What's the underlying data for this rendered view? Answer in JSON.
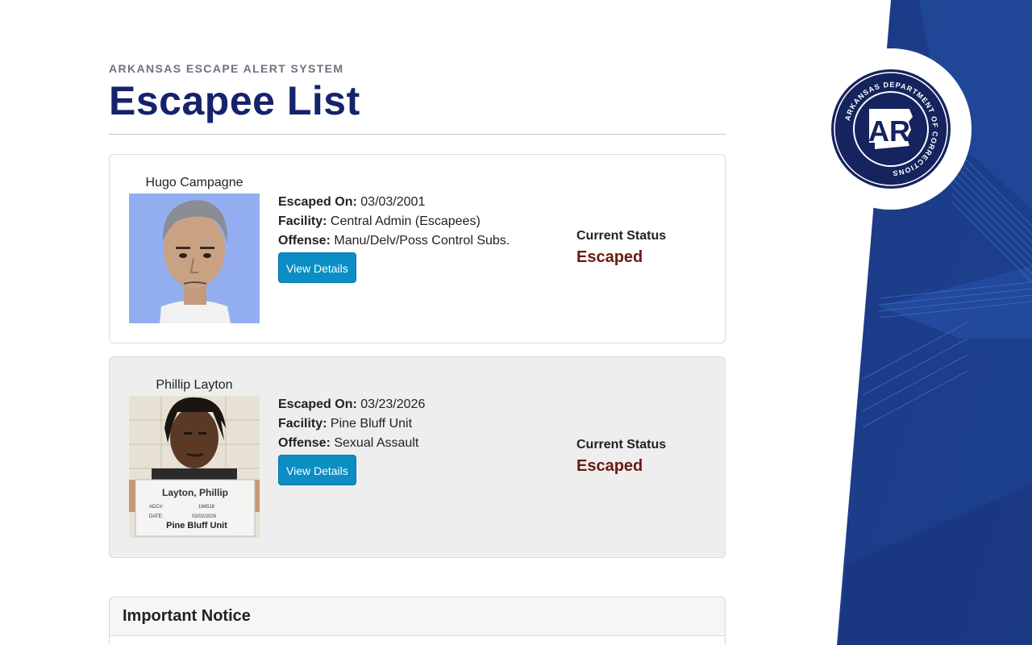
{
  "header": {
    "eyebrow": "ARKANSAS ESCAPE ALERT SYSTEM",
    "title": "Escapee List"
  },
  "seal": {
    "ring_text": "ARKANSAS DEPARTMENT OF CORRECTIONS",
    "monogram": "AR",
    "icon": "arkansas-doc-seal"
  },
  "labels": {
    "escaped_on": "Escaped On:",
    "facility": "Facility:",
    "offense": "Offense:",
    "view_details": "View Details",
    "current_status": "Current Status"
  },
  "escapees": [
    {
      "name": "Hugo Campagne",
      "escaped_on": "03/03/2001",
      "facility": "Central Admin (Escapees)",
      "offense": "Manu/Delv/Poss Control Subs.",
      "status": "Escaped"
    },
    {
      "name": "Phillip Layton",
      "escaped_on": "03/23/2026",
      "facility": "Pine Bluff Unit",
      "offense": "Sexual Assault",
      "status": "Escaped",
      "placard": {
        "name": "Layton, Phillip",
        "adc_label": "ADC#:",
        "adc_number": "184518",
        "date_label": "DATE:",
        "date": "02/02/2026",
        "unit": "Pine Bluff Unit"
      }
    }
  ],
  "notice": {
    "title": "Important Notice"
  },
  "colors": {
    "title": "#15236b",
    "button": "#0a8ec4",
    "status": "#6b1a10",
    "panel": "#1c3f8f"
  }
}
